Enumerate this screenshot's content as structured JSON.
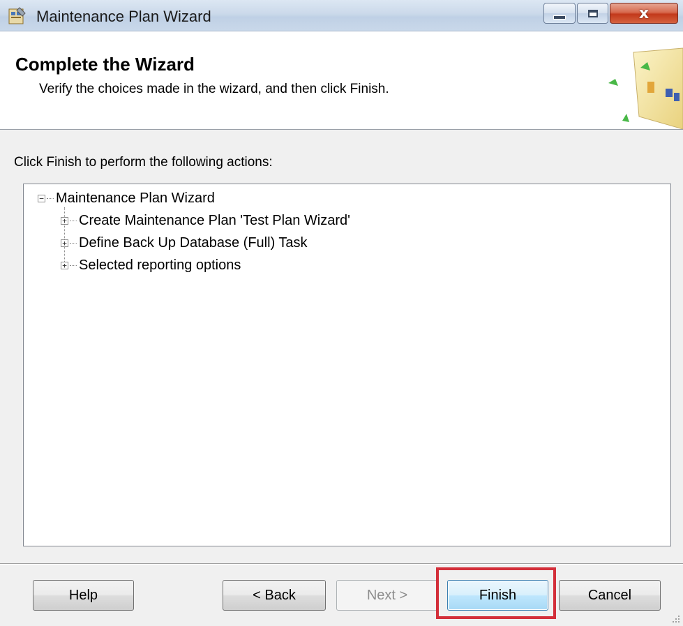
{
  "window": {
    "title": "Maintenance Plan Wizard",
    "icon": "maintenance-plan-wizard-icon",
    "controls": [
      "minimize-icon",
      "maximize-icon",
      "close-icon"
    ]
  },
  "header": {
    "title": "Complete the Wizard",
    "subtitle": "Verify the choices made in the wizard, and then click Finish.",
    "graphic": "wizard-graphic-icon"
  },
  "instruction": "Click Finish to perform the following actions:",
  "tree": {
    "root": {
      "label": "Maintenance Plan Wizard",
      "expander": "−"
    },
    "children": [
      {
        "label": "Create Maintenance Plan 'Test Plan Wizard'",
        "expander": "+"
      },
      {
        "label": "Define Back Up Database (Full) Task",
        "expander": "+"
      },
      {
        "label": "Selected reporting options",
        "expander": "+"
      }
    ]
  },
  "buttons": {
    "help": "Help",
    "back": "< Back",
    "next": "Next >",
    "finish": "Finish",
    "cancel": "Cancel"
  },
  "colors": {
    "highlight": "#d32f3a",
    "finish_border": "#3c7fb1",
    "close_button": "#c2391b"
  }
}
